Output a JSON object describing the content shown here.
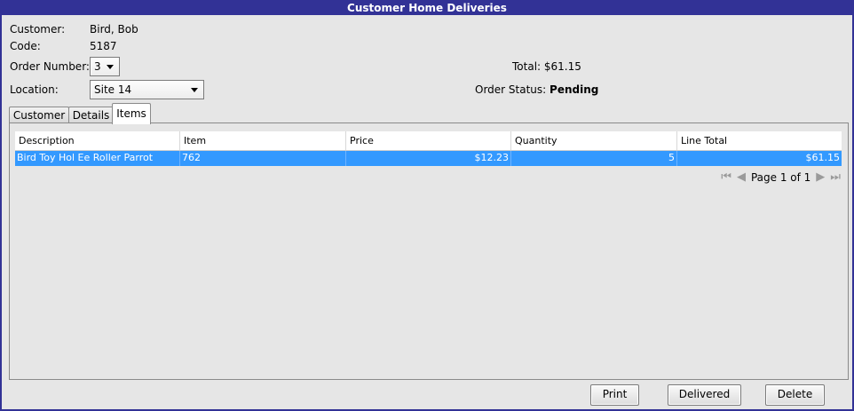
{
  "window": {
    "title": "Customer Home Deliveries"
  },
  "form": {
    "customer_label": "Customer:",
    "customer_value": "Bird, Bob",
    "code_label": "Code:",
    "code_value": "5187",
    "order_number_label": "Order Number:",
    "order_number_value": "3",
    "location_label": "Location:",
    "location_value": "Site 14",
    "total_label": "Total:",
    "total_value": "$61.15",
    "status_label": "Order Status:",
    "status_value": "Pending"
  },
  "tabs": [
    {
      "label": "Customer"
    },
    {
      "label": "Details"
    },
    {
      "label": "Items",
      "active": true
    }
  ],
  "grid": {
    "columns": [
      "Description",
      "Item",
      "Price",
      "Quantity",
      "Line Total"
    ],
    "rows": [
      {
        "description": "Bird Toy Hol Ee Roller Parrot",
        "item": "762",
        "price": "$12.23",
        "quantity": "5",
        "line_total": "$61.15",
        "selected": true
      }
    ]
  },
  "pager": {
    "text": "Page 1 of 1"
  },
  "buttons": {
    "print": "Print",
    "delivered": "Delivered",
    "delete": "Delete"
  },
  "colors": {
    "title_bar": "#323296",
    "selection": "#3399ff"
  }
}
